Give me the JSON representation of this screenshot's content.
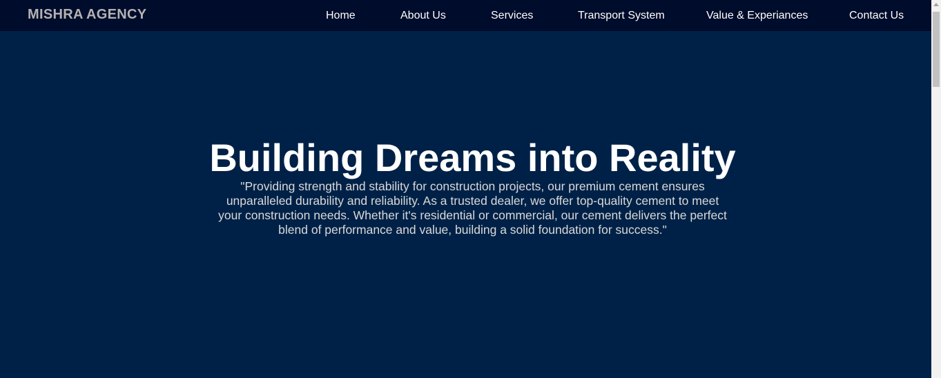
{
  "navbar": {
    "brand": "MISHRA AGENCY",
    "links": [
      {
        "label": "Home"
      },
      {
        "label": "About Us"
      },
      {
        "label": "Services"
      },
      {
        "label": "Transport System"
      },
      {
        "label": "Value & Experiances"
      },
      {
        "label": "Contact Us"
      }
    ]
  },
  "hero": {
    "title": "Building Dreams into Reality",
    "text": "\"Providing strength and stability for construction projects, our premium cement ensures unparalleled durability and reliability. As a trusted dealer, we offer top-quality cement to meet your construction needs. Whether it's residential or commercial, our cement delivers the perfect blend of performance and value, building a solid foundation for success.\""
  },
  "colors": {
    "navbar_background": "#000c2b",
    "page_background": "#002147",
    "brand_text": "#b3b3b3",
    "nav_text": "#ffffff",
    "hero_title": "#ffffff",
    "hero_text": "#d9d9d9"
  }
}
